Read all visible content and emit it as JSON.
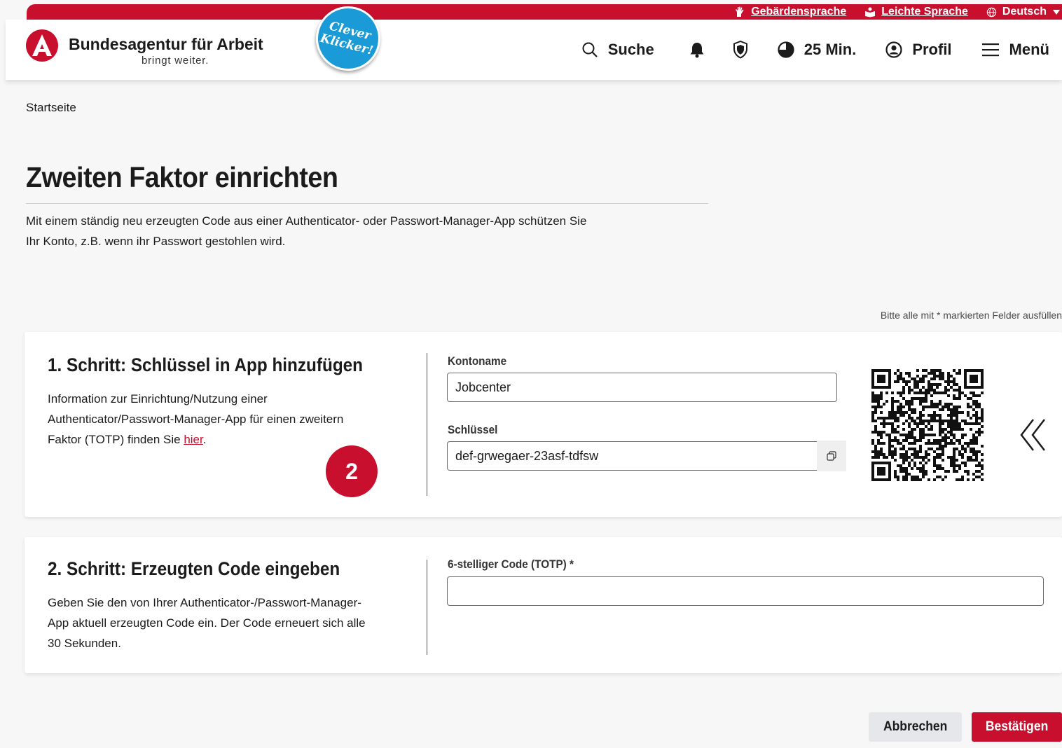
{
  "topbar": {
    "sign_language": "Gebärdensprache",
    "easy_language": "Leichte Sprache",
    "language": "Deutsch"
  },
  "header": {
    "brand_name": "Bundesagentur für Arbeit",
    "brand_slogan": "bringt weiter.",
    "badge_line1": "Clever",
    "badge_line2": "Klicker!",
    "nav": {
      "search": "Suche",
      "session_timer": "25 Min.",
      "profile": "Profil",
      "menu": "Menü"
    }
  },
  "breadcrumb": "Startseite",
  "page": {
    "title": "Zweiten Faktor einrichten",
    "intro_line1": "Mit einem ständig neu erzeugten Code aus einer Authenticator- oder Passwort-Manager-App schützen Sie",
    "intro_line2": "Ihr Konto, z.B. wenn ihr Passwort gestohlen wird.",
    "required_hint": "Bitte alle mit * markierten Felder ausfüllen"
  },
  "step1": {
    "title": "1. Schritt: Schlüssel in App hinzufügen",
    "text_line1": "Information zur Einrichtung/Nutzung einer",
    "text_line2": "Authenticator/Passwort-Manager-App für einen zweitern",
    "text_line3_prefix": "Faktor (TOTP) finden Sie ",
    "link": "hier",
    "text_line3_suffix": ".",
    "annotation_number": "2",
    "account_label": "Kontoname",
    "account_value": "Jobcenter",
    "key_label": "Schlüssel",
    "key_value": "def-grwegaer-23asf-tdfsw"
  },
  "step2": {
    "title": "2. Schritt: Erzeugten Code eingeben",
    "text_line1": "Geben Sie den von Ihrer Authenticator-/Passwort-Manager-",
    "text_line2": "App aktuell erzeugten Code ein. Der Code erneuert sich alle",
    "text_line3": "30 Sekunden.",
    "code_label": "6-stelliger Code (TOTP) *",
    "code_value": ""
  },
  "buttons": {
    "cancel": "Abbrechen",
    "confirm": "Bestätigen"
  },
  "colors": {
    "brand_red": "#c8102e",
    "badge_blue": "#1a9ad6"
  },
  "icons": [
    "hand-icon",
    "easy-language-icon",
    "globe-icon",
    "chevron-down-icon",
    "search-icon",
    "bell-icon",
    "shield-icon",
    "timer-icon",
    "profile-icon",
    "menu-icon",
    "copy-icon",
    "qr-code",
    "double-chevron-left-icon"
  ]
}
